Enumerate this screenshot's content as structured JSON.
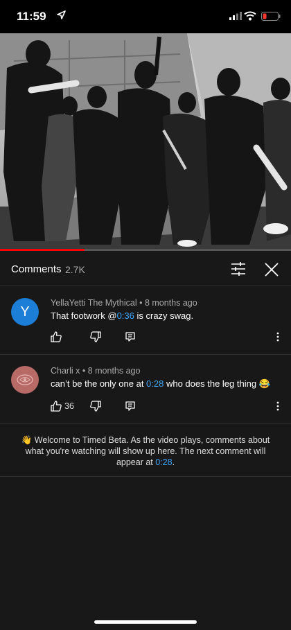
{
  "status_bar": {
    "time": "11:59",
    "icons": [
      "location-arrow-icon",
      "cellular-signal-icon",
      "wifi-icon",
      "battery-low-icon"
    ],
    "battery_color": "#ff3b30"
  },
  "video": {
    "progress": 0.29,
    "progress_color": "#ff0000"
  },
  "comments_panel": {
    "title": "Comments",
    "count": "2.7K",
    "icons": [
      "filter-sliders-icon",
      "close-icon"
    ]
  },
  "comments": [
    {
      "avatar_letter": "Y",
      "avatar_color": "#1c7ed6",
      "author": "YellaYetti The Mythical",
      "sep": " • ",
      "age": "8 months ago",
      "text_before": "That footwork @",
      "timestamp": "0:36",
      "text_after": " is crazy swag.",
      "likes": ""
    },
    {
      "avatar_letter": "",
      "avatar_color": "#b86a66",
      "author": "Charli x",
      "sep": " • ",
      "age": "8 months ago",
      "text_before": "can’t be the only one at ",
      "timestamp": "0:28",
      "text_after": " who does the leg thing 😂",
      "likes": "36"
    }
  ],
  "timed_beta": {
    "emoji": "👋",
    "text": " Welcome to Timed Beta. As the video plays, comments about what you're watching will show up here. The next comment will appear at ",
    "timestamp": "0:28",
    "end": "."
  },
  "accent_link": "#3ea6ff"
}
